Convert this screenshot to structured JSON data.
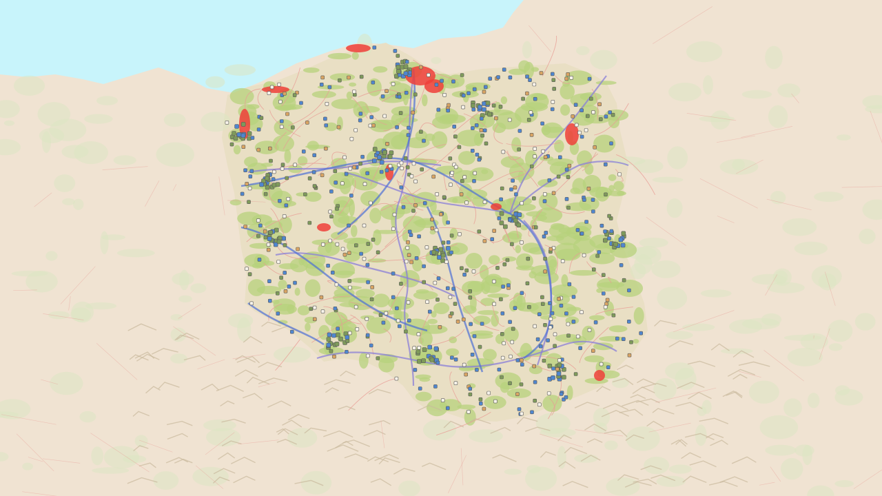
{
  "map": {
    "colors": {
      "background": "#efe6d8",
      "sea": "#c8f4fb",
      "land_outside": "#f0e3d2",
      "forest_outside": "#dde5c2",
      "land_poland": "#e9dfc4",
      "forest_poland": "#b7d27c",
      "rivers": "#8a7fd8",
      "corridors_blue": "#4d6fd6",
      "roads": "#e89c95",
      "red_zones": "#ef3f3a",
      "mountains": "#c9b99c",
      "point_blue": "#4f86cf",
      "point_olive": "#7e9a5a",
      "point_white": "#f7f3ea",
      "point_orange": "#d9a463",
      "point_stroke": "#5a5a5a"
    },
    "layers": [
      "sea",
      "land",
      "poland-area",
      "forests",
      "rivers",
      "road-network",
      "protected-zones",
      "site-points"
    ]
  }
}
